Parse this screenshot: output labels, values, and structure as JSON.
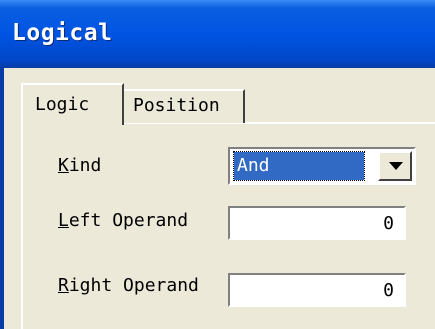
{
  "window": {
    "title": "Logical"
  },
  "tabs": [
    {
      "label": "Logic",
      "active": true
    },
    {
      "label": "Position",
      "active": false
    }
  ],
  "fields": {
    "kind": {
      "label_mnemonic": "K",
      "label_rest": "ind",
      "selected": "And"
    },
    "left_operand": {
      "label_mnemonic": "L",
      "label_rest": "eft Operand",
      "value": "0"
    },
    "right_operand": {
      "label_mnemonic": "R",
      "label_rest": "ight Operand",
      "value": "0"
    }
  },
  "icons": {
    "combo_arrow": "chevron-down-icon"
  },
  "colors": {
    "titlebar": "#0054e3",
    "selection": "#316ac5",
    "dialog_bg": "#ece9d8"
  }
}
